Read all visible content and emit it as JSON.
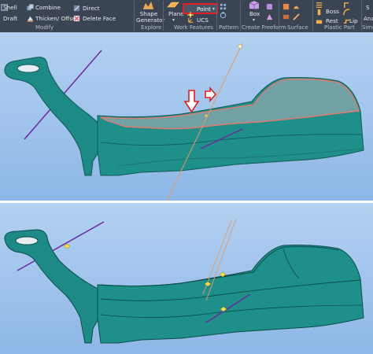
{
  "ribbon": {
    "modify": {
      "shell_label": "Shell",
      "draft_label": "Draft",
      "combine_label": "Combine",
      "thicken_label": "Thicken/ Offset",
      "direct_label": "Direct",
      "delete_face_label": "Delete Face",
      "group_label": "Modify"
    },
    "explore": {
      "shape_generator_line1": "Shape",
      "shape_generator_line2": "Generator",
      "group_label": "Explore"
    },
    "work_features": {
      "plane_label": "Plane",
      "point_label": "Point",
      "ucs_label": "UCS",
      "group_label": "Work Features"
    },
    "pattern": {
      "group_label": "Pattern"
    },
    "create_freeform": {
      "box_label": "Box",
      "group_label": "Create Freeform"
    },
    "surface": {
      "group_label": "Surface"
    },
    "plastic_part": {
      "boss_label": "Boss",
      "rest_label": "Rest",
      "lip_label": "Lip",
      "group_label": "Plastic Part"
    },
    "simulation": {
      "group_label_partial": "Simu",
      "top_partial": "S",
      "analysis_partial": "Ana"
    }
  },
  "colors": {
    "ribbon_bg": "#3b4453",
    "viewport_bg": "#9fc3ec",
    "model_teal": "#1f8f8a",
    "selection_outline": "#e07a6c",
    "work_axis": "#6a2aa0",
    "highlight_red": "#e01e24"
  },
  "icons": {
    "point_icon": "point-icon",
    "pointer_arrow": "red-down-arrow-icon",
    "pointer_arrow_right": "red-right-arrow-icon"
  }
}
